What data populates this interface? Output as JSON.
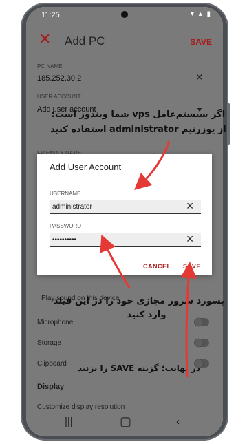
{
  "status_bar": {
    "time": "11:25"
  },
  "toolbar": {
    "title": "Add PC",
    "save_label": "SAVE"
  },
  "form": {
    "pc_name_label": "PC NAME",
    "pc_name_value": "185.252.30.2",
    "user_account_label": "USER ACCOUNT",
    "user_account_value": "Add user account",
    "friendly_name_label": "FRIENDLY NAME"
  },
  "settings": {
    "play_sound": "Play sound on this device",
    "microphone": "Microphone",
    "storage": "Storage",
    "clipboard": "Clipboard",
    "display_section": "Display",
    "customize_resolution": "Customize display resolution"
  },
  "dialog": {
    "title": "Add User Account",
    "username_label": "USERNAME",
    "username_value": "administrator",
    "password_label": "PASSWORD",
    "password_value": "••••••••••",
    "cancel_label": "CANCEL",
    "save_label": "SAVE"
  },
  "annotations": {
    "note_1_line_1": "اگر سیستم‌عامل vps شما ویندوز است؛",
    "note_1_line_2": "از یوزرنیم administrator استفاده کنید",
    "note_2_line_1": "پسورد سرور مجازی خود را در این فیلد",
    "note_2_line_2": "وارد کنید",
    "note_3": "در نهایت؛ گزینه SAVE را بزنید"
  },
  "colors": {
    "accent": "#a71b1b",
    "dim_overlay": "#7a7a7a",
    "arrow": "#e53935"
  },
  "icons": [
    "close-icon",
    "clear-icon",
    "dropdown-arrow-icon",
    "recents-icon",
    "home-icon",
    "back-icon"
  ]
}
